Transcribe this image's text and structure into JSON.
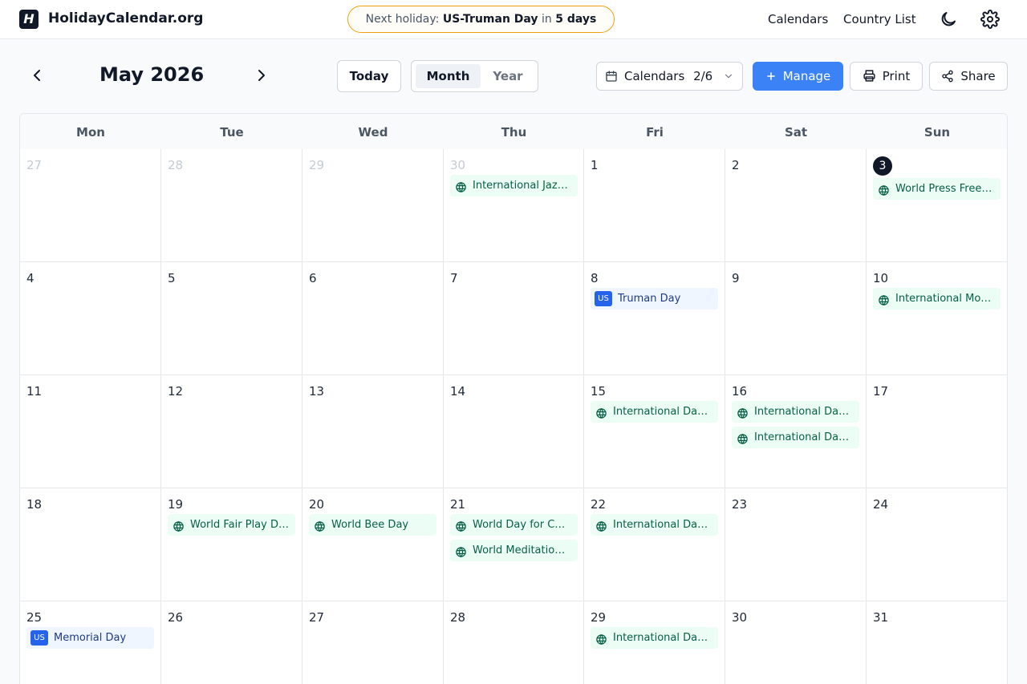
{
  "header": {
    "logo_letter": "H",
    "brand": "HolidayCalendar.org",
    "next_holiday": {
      "prefix": "Next holiday:",
      "name": "US-Truman Day",
      "in": "in",
      "countdown": "5 days"
    },
    "nav": {
      "calendars": "Calendars",
      "country_list": "Country List"
    },
    "icons": [
      "moon-icon",
      "gear-icon"
    ]
  },
  "toolbar": {
    "month_title": "May 2026",
    "today": "Today",
    "view_tabs": [
      {
        "label": "Month",
        "active": true
      },
      {
        "label": "Year",
        "active": false
      }
    ],
    "calendars_label": "Calendars",
    "calendars_count": "2/6",
    "manage": "Manage",
    "print": "Print",
    "share": "Share"
  },
  "calendar": {
    "weekdays": [
      "Mon",
      "Tue",
      "Wed",
      "Thu",
      "Fri",
      "Sat",
      "Sun"
    ],
    "today_day": 3,
    "weeks": [
      [
        {
          "day": "27",
          "muted": true,
          "events": []
        },
        {
          "day": "28",
          "muted": true,
          "events": []
        },
        {
          "day": "29",
          "muted": true,
          "events": []
        },
        {
          "day": "30",
          "muted": true,
          "events": [
            {
              "type": "global",
              "label": "International Jazz Day"
            }
          ]
        },
        {
          "day": "1",
          "events": []
        },
        {
          "day": "2",
          "events": []
        },
        {
          "day": "3",
          "today": true,
          "events": [
            {
              "type": "global",
              "label": "World Press Freedom Day"
            }
          ]
        }
      ],
      [
        {
          "day": "4",
          "events": []
        },
        {
          "day": "5",
          "events": []
        },
        {
          "day": "6",
          "events": []
        },
        {
          "day": "7",
          "events": []
        },
        {
          "day": "8",
          "events": [
            {
              "type": "us",
              "badge": "US",
              "label": "Truman Day"
            }
          ]
        },
        {
          "day": "9",
          "events": []
        },
        {
          "day": "10",
          "events": [
            {
              "type": "global",
              "label": "International Mother's Day"
            }
          ]
        }
      ],
      [
        {
          "day": "11",
          "events": []
        },
        {
          "day": "12",
          "events": []
        },
        {
          "day": "13",
          "events": []
        },
        {
          "day": "14",
          "events": []
        },
        {
          "day": "15",
          "events": [
            {
              "type": "global",
              "label": "International Day of Families"
            }
          ]
        },
        {
          "day": "16",
          "events": [
            {
              "type": "global",
              "label": "International Day of Light"
            },
            {
              "type": "global",
              "label": "International Day of Living Together in Peace"
            }
          ]
        },
        {
          "day": "17",
          "events": []
        }
      ],
      [
        {
          "day": "18",
          "events": []
        },
        {
          "day": "19",
          "events": [
            {
              "type": "global",
              "label": "World Fair Play Day"
            }
          ]
        },
        {
          "day": "20",
          "events": [
            {
              "type": "global",
              "label": "World Bee Day"
            }
          ]
        },
        {
          "day": "21",
          "events": [
            {
              "type": "global",
              "label": "World Day for Cultural Diversity"
            },
            {
              "type": "global",
              "label": "World Meditation Day"
            }
          ]
        },
        {
          "day": "22",
          "events": [
            {
              "type": "global",
              "label": "International Day for Biological Diversity"
            }
          ]
        },
        {
          "day": "23",
          "events": []
        },
        {
          "day": "24",
          "events": []
        }
      ],
      [
        {
          "day": "25",
          "events": [
            {
              "type": "us",
              "badge": "US",
              "label": "Memorial Day"
            }
          ]
        },
        {
          "day": "26",
          "events": []
        },
        {
          "day": "27",
          "events": []
        },
        {
          "day": "28",
          "events": []
        },
        {
          "day": "29",
          "events": [
            {
              "type": "global",
              "label": "International Day of UN Peacekeepers"
            }
          ]
        },
        {
          "day": "30",
          "events": []
        },
        {
          "day": "31",
          "events": []
        }
      ]
    ]
  },
  "colors": {
    "accent": "#3b82f6",
    "us_badge": "#2563eb",
    "global_event_bg": "#ecfdf5",
    "global_event_text": "#065f46",
    "us_event_bg": "#eff6ff",
    "next_pill_border": "#f59e0b"
  }
}
